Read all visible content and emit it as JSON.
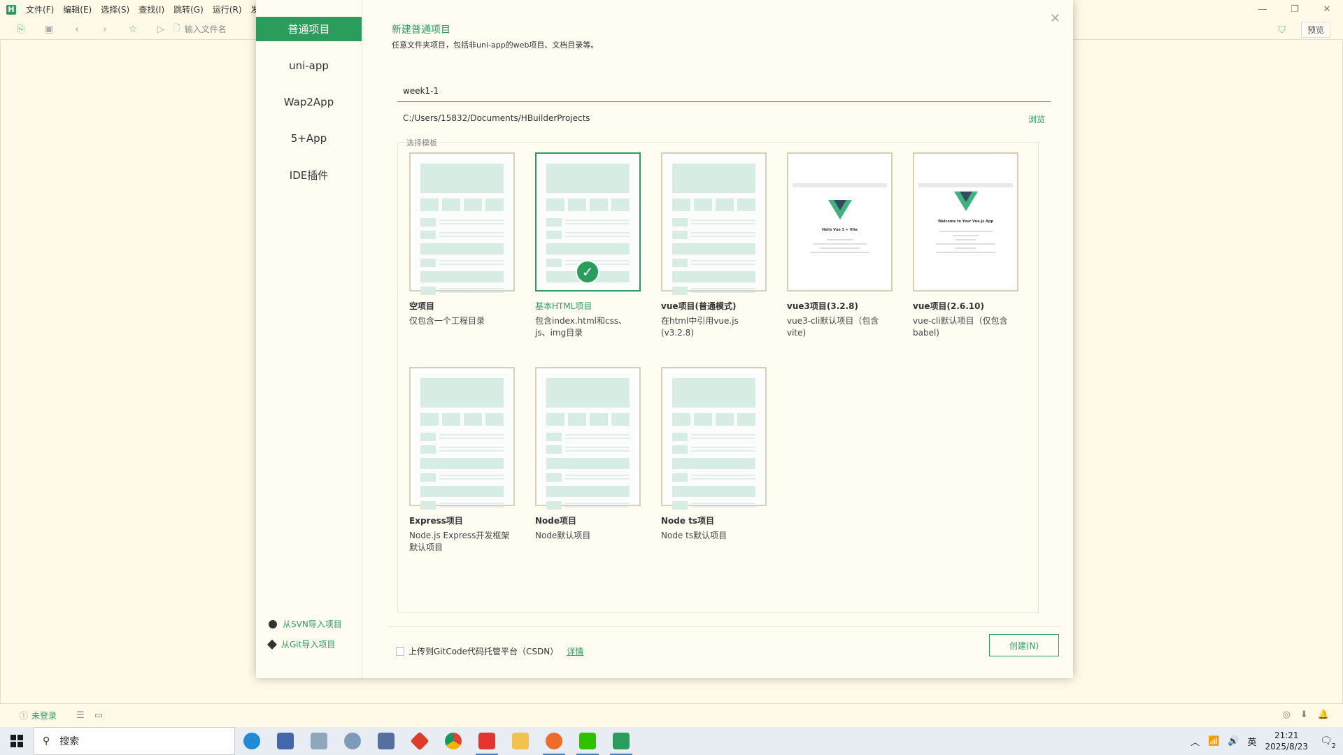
{
  "ide": {
    "menu": [
      "文件(F)",
      "编辑(E)",
      "选择(S)",
      "查找(I)",
      "跳转(G)",
      "运行(R)",
      "发"
    ],
    "file_input_placeholder": "输入文件名",
    "preview_label": "预览",
    "status_login": "未登录"
  },
  "dialog": {
    "sidebar": [
      "普通项目",
      "uni-app",
      "Wap2App",
      "5+App",
      "IDE插件"
    ],
    "import_svn": "从SVN导入项目",
    "import_git": "从Git导入项目",
    "title": "新建普通项目",
    "subtitle": "任意文件夹项目，包括非uni-app的web项目、文档目录等。",
    "project_name": "week1-1",
    "path": "C:/Users/15832/Documents/HBuilderProjects",
    "browse_label": "浏览",
    "template_legend": "选择模板",
    "templates": [
      {
        "name": "空项目",
        "desc": "仅包含一个工程目录"
      },
      {
        "name": "基本HTML项目",
        "desc": "包含index.html和css、js、img目录"
      },
      {
        "name": "vue项目(普通模式)",
        "desc": "在html中引用vue.js (v3.2.8)"
      },
      {
        "name": "vue3项目(3.2.8)",
        "desc": "vue3-cli默认项目（包含vite)",
        "shot_title": "Hello Vue 3 + Vite"
      },
      {
        "name": "vue项目(2.6.10)",
        "desc": "vue-cli默认项目（仅包含babel)",
        "shot_title": "Welcome to Your Vue.js App"
      },
      {
        "name": "Express项目",
        "desc": "Node.js Express开发框架默认项目"
      },
      {
        "name": "Node项目",
        "desc": "Node默认项目"
      },
      {
        "name": "Node ts项目",
        "desc": "Node ts默认项目"
      }
    ],
    "gitcode_label": "上传到GitCode代码托管平台（CSDN）",
    "detail_label": "详情",
    "create_label": "创建(N)"
  },
  "taskbar": {
    "search_label": "搜索",
    "ime": "英",
    "time": "21:21",
    "date": "2025/8/23",
    "notifications": "2"
  },
  "colors": {
    "accent": "#2a9d5c",
    "background": "#fffae8"
  }
}
